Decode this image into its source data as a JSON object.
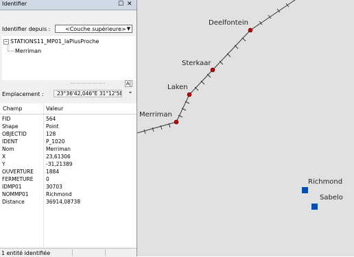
{
  "window": {
    "title": "Identifier"
  },
  "identify_from": {
    "label": "Identifier depuis :",
    "selected": "<Couche supérieure>"
  },
  "tree": {
    "layer": "STATIONS11_MP01_laPlusProche",
    "feature": "Merriman"
  },
  "location": {
    "label": "Emplacement :",
    "value": "23°36'42,046\"E 31°12'58"
  },
  "table": {
    "headers": [
      "Champ",
      "Valeur"
    ],
    "rows": [
      {
        "field": "FID",
        "value": "564"
      },
      {
        "field": "Shape",
        "value": "Point"
      },
      {
        "field": "OBJECTID",
        "value": "128"
      },
      {
        "field": "IDENT",
        "value": "P_1020"
      },
      {
        "field": "Nom",
        "value": "Merriman"
      },
      {
        "field": "X",
        "value": "23,61306"
      },
      {
        "field": "Y",
        "value": "-31,21389"
      },
      {
        "field": "OUVERTURE",
        "value": "1884"
      },
      {
        "field": "FERMETURE",
        "value": "0"
      },
      {
        "field": "IDMP01",
        "value": "30703"
      },
      {
        "field": "NOMMP01",
        "value": "Richmond"
      },
      {
        "field": "Distance",
        "value": "36914,08738"
      }
    ]
  },
  "status": {
    "text": "1 entité identifiée"
  },
  "map": {
    "stations": [
      "Deelfontein",
      "Sterkaar",
      "Laken",
      "Merriman"
    ],
    "points": [
      "Richmond",
      "Sabelo"
    ],
    "colors": {
      "background": "#e1e1e1",
      "station": "#c00000",
      "point": "#0050b4",
      "line": "#333333"
    }
  }
}
